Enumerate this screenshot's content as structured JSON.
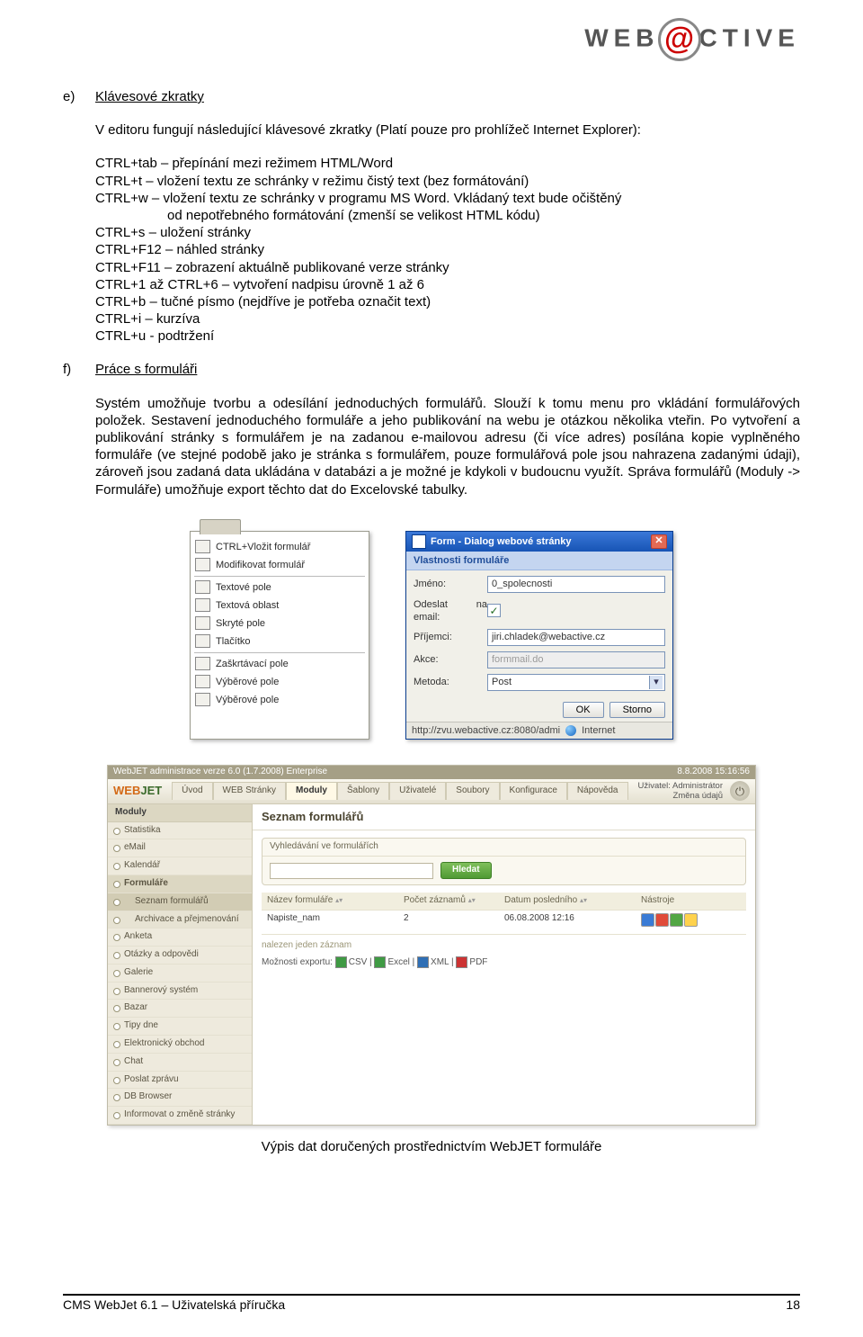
{
  "brand": {
    "left": "WEB",
    "right": "CTIVE"
  },
  "sections": {
    "e": {
      "marker": "e)",
      "title": "Klávesové zkratky",
      "intro": "V editoru fungují následující klávesové zkratky (Platí pouze pro prohlížeč Internet Explorer):",
      "shortcuts_before_note": "CTRL+tab – přepínání mezi režimem HTML/Word\nCTRL+t – vložení textu ze schránky v režimu čistý text (bez formátování)\nCTRL+w – vložení textu ze schránky v programu MS Word. Vkládaný text bude očištěný",
      "shortcut_note_indent": "od nepotřebného formátování (zmenší se velikost HTML kódu)",
      "shortcuts_after_note": "CTRL+s – uložení stránky\nCTRL+F12 – náhled stránky\nCTRL+F11 – zobrazení aktuálně publikované verze stránky\nCTRL+1 až CTRL+6 – vytvoření nadpisu úrovně 1 až 6\nCTRL+b – tučné písmo (nejdříve je potřeba označit text)\nCTRL+i – kurzíva\nCTRL+u - podtržení"
    },
    "f": {
      "marker": "f)",
      "title": "Práce s formuláři",
      "paragraph": "Systém umožňuje tvorbu a odesílání jednoduchých formulářů. Slouží k tomu menu pro vkládání formulářových položek. Sestavení jednoduchého formuláře a jeho publikování na webu je otázkou několika vteřin. Po vytvoření a publikování stránky s formulářem je na zadanou e-mailovou adresu (či více adres) posílána kopie vyplněného formuláře (ve stejné podobě jako je stránka s formulářem, pouze formulářová pole jsou nahrazena zadanými údaji), zároveň jsou zadaná data ukládána v databázi a je možné je kdykoli v budoucnu využít. Správa formulářů (Moduly -> Formuláře) umožňuje export těchto dat do Excelovské tabulky."
    }
  },
  "context_menu": {
    "items": [
      "CTRL+Vložit formulář",
      "Modifikovat formulář",
      "Textové pole",
      "Textová oblast",
      "Skryté pole",
      "Tlačítko",
      "Zaškrtávací pole",
      "Výběrové pole",
      "Výběrové pole"
    ],
    "separators_after": [
      1,
      5
    ]
  },
  "dialog": {
    "title": "Form - Dialog webové stránky",
    "section_title": "Vlastnosti formuláře",
    "close_glyph": "✕",
    "fields": {
      "name": {
        "label": "Jméno:",
        "value": "0_spolecnosti"
      },
      "send": {
        "label": "Odeslat na email:",
        "checked": true
      },
      "rcpt": {
        "label": "Příjemci:",
        "value": "jiri.chladek@webactive.cz"
      },
      "action": {
        "label": "Akce:",
        "value": "formmail.do",
        "disabled": true
      },
      "method": {
        "label": "Metoda:",
        "value": "Post"
      }
    },
    "buttons": {
      "ok": "OK",
      "cancel": "Storno"
    },
    "status": {
      "url": "http://zvu.webactive.cz:8080/admi",
      "zone": "Internet"
    }
  },
  "admin": {
    "top_strip": {
      "left": "WebJET administrace verze 6.0 (1.7.2008) Enterprise",
      "right": "8.8.2008 15:16:56"
    },
    "brand": {
      "w1": "WEB",
      "w2": "JET"
    },
    "tabs": [
      "Úvod",
      "WEB Stránky",
      "Moduly",
      "Šablony",
      "Uživatelé",
      "Soubory",
      "Konfigurace",
      "Nápověda"
    ],
    "active_tab_index": 2,
    "user": {
      "l1": "Uživatel: Administrátor",
      "l2": "Změna údajů"
    },
    "sidebar": {
      "title": "Moduly",
      "items": [
        {
          "label": "Statistika"
        },
        {
          "label": "eMail"
        },
        {
          "label": "Kalendář"
        },
        {
          "label": "Formuláře",
          "open": true,
          "sub": [
            {
              "label": "Seznam formulářů",
              "active": true
            },
            {
              "label": "Archivace a přejmenování"
            }
          ]
        },
        {
          "label": "Anketa"
        },
        {
          "label": "Otázky a odpovědi"
        },
        {
          "label": "Galerie"
        },
        {
          "label": "Bannerový systém"
        },
        {
          "label": "Bazar"
        },
        {
          "label": "Tipy dne"
        },
        {
          "label": "Elektronický obchod"
        },
        {
          "label": "Chat"
        },
        {
          "label": "Poslat zprávu"
        },
        {
          "label": "DB Browser"
        },
        {
          "label": "Informovat o změně stránky"
        }
      ]
    },
    "main": {
      "title": "Seznam formulářů",
      "search": {
        "header": "Vyhledávání ve formulářích",
        "button": "Hledat"
      },
      "grid": {
        "columns": [
          "Název formuláře",
          "Počet záznamů",
          "Datum posledního",
          "Nástroje"
        ],
        "row": {
          "name": "Napiste_nam",
          "count": "2",
          "date": "06.08.2008 12:16"
        }
      },
      "found_text": "nalezen jeden záznam",
      "export": {
        "label": "Možnosti exportu:",
        "formats": [
          "CSV",
          "Excel",
          "XML",
          "PDF"
        ]
      }
    }
  },
  "caption": "Výpis dat doručených prostřednictvím WebJET formuláře",
  "footer": {
    "left": "CMS WebJet 6.1 – Uživatelská příručka",
    "right": "18"
  }
}
